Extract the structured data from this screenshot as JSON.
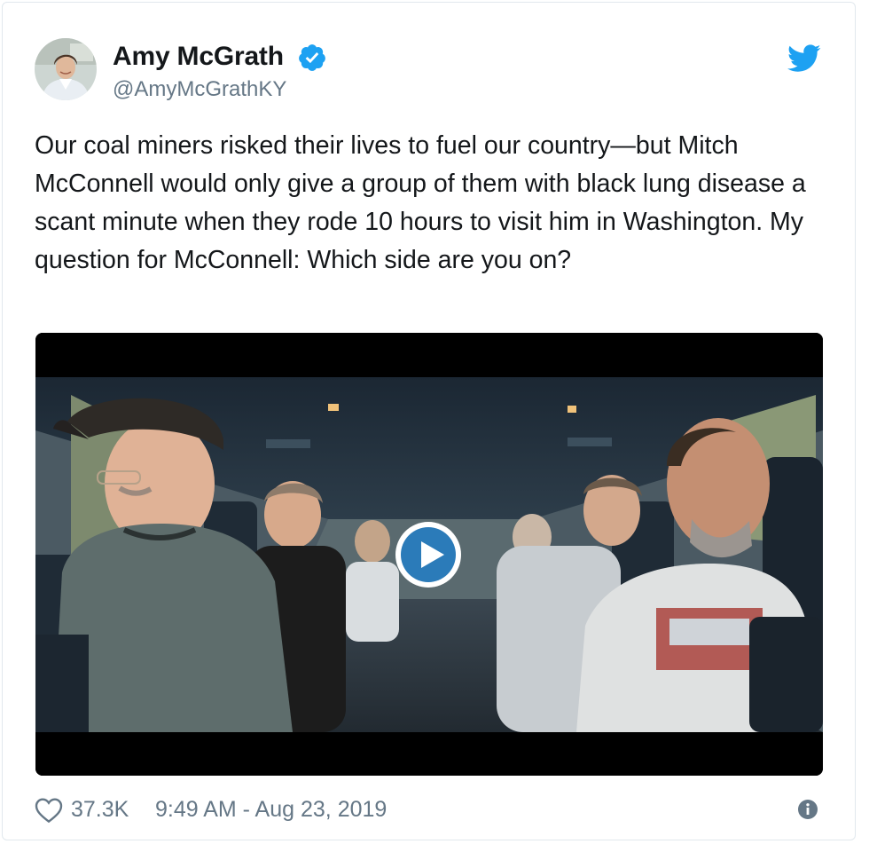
{
  "tweet": {
    "author": {
      "display_name": "Amy McGrath",
      "handle": "@AmyMcGrathKY",
      "verified": true,
      "avatar_icon": "profile-photo"
    },
    "text": "Our coal miners risked their lives to fuel our country—but Mitch McConnell would only give a group of them with black lung disease a scant minute when they rode 10 hours to visit him in Washington. My question for McConnell: Which side are you on?",
    "media": {
      "type": "video",
      "play_icon": "play-icon",
      "description_icon": "bus-interior-video-frame"
    },
    "likes": "37.3K",
    "timestamp": "9:49 AM - Aug 23, 2019",
    "icons": {
      "brand": "twitter-bird-icon",
      "like": "heart-icon",
      "info": "info-icon",
      "verified": "verified-badge-icon"
    },
    "colors": {
      "brand_blue": "#1da1f2",
      "text_primary": "#14171a",
      "text_secondary": "#657786",
      "play_blue": "#2b7bb9"
    }
  }
}
